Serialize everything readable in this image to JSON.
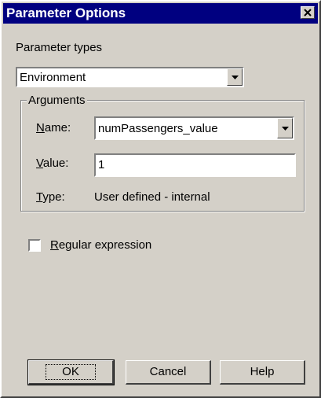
{
  "window": {
    "title": "Parameter Options"
  },
  "parameter_types": {
    "label": "Parameter types",
    "value": "Environment"
  },
  "arguments": {
    "legend": "Arguments",
    "name": {
      "label_u": "N",
      "label_rest": "ame:",
      "value": "numPassengers_value"
    },
    "value": {
      "label_u": "V",
      "label_rest": "alue:",
      "value": "1"
    },
    "type": {
      "label_u": "T",
      "label_rest": "ype:",
      "value": "User defined - internal"
    }
  },
  "regex": {
    "label_u": "R",
    "label_rest": "egular expression",
    "checked": false
  },
  "buttons": {
    "ok": "OK",
    "cancel": "Cancel",
    "help": "Help"
  },
  "icons": {
    "close": "close-icon",
    "dropdown": "chevron-down-icon"
  }
}
